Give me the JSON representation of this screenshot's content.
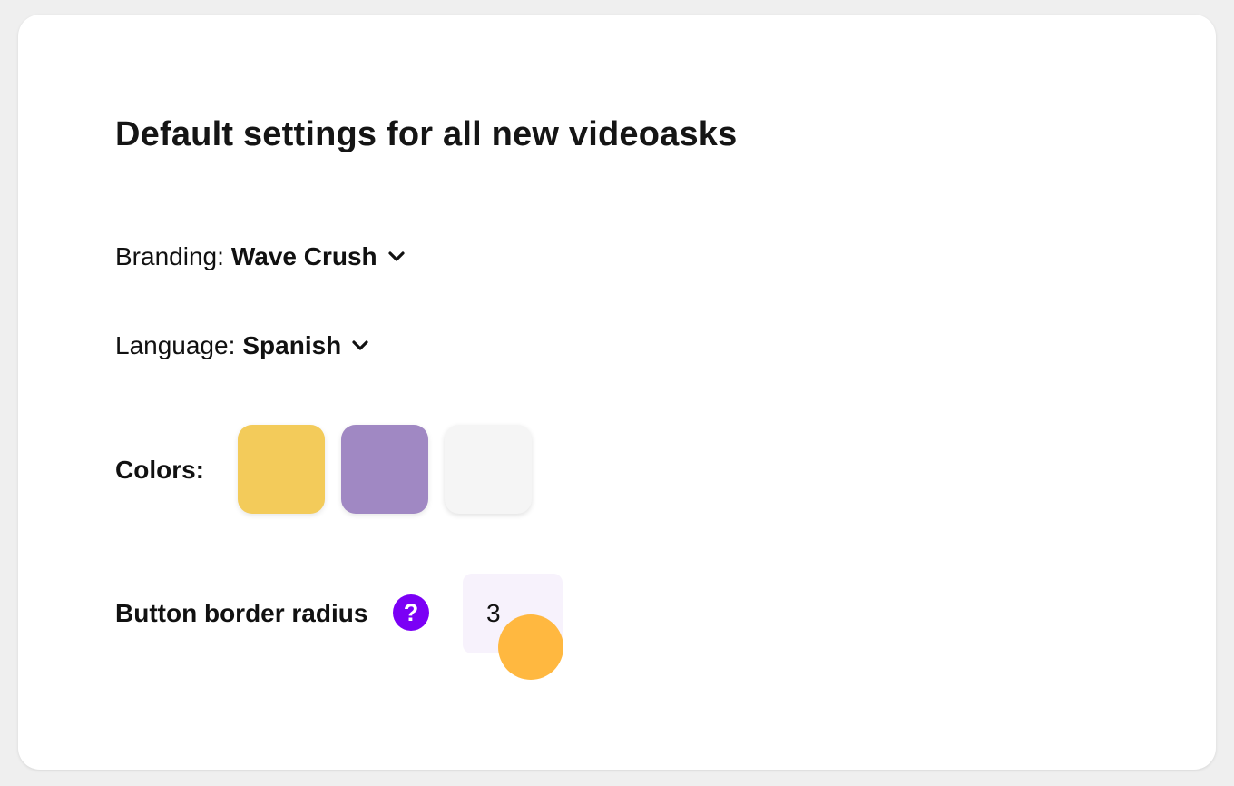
{
  "settings": {
    "title": "Default settings for all new videoasks",
    "branding": {
      "label": "Branding:",
      "value": "Wave Crush",
      "icon": "chevron-down-icon"
    },
    "language": {
      "label": "Language:",
      "value": "Spanish",
      "icon": "chevron-down-icon"
    },
    "colors": {
      "label": "Colors:",
      "swatches": [
        "#F3CB5A",
        "#A088C3",
        "#F5F5F5"
      ]
    },
    "button_radius": {
      "label": "Button border radius",
      "help_icon": "question-mark-icon",
      "help_symbol": "?",
      "help_color": "#7B00F5",
      "value": "3",
      "input_bg": "#F7F2FC"
    }
  },
  "pointer": {
    "icon": "cursor-dot-icon",
    "color": "#FFB436"
  }
}
